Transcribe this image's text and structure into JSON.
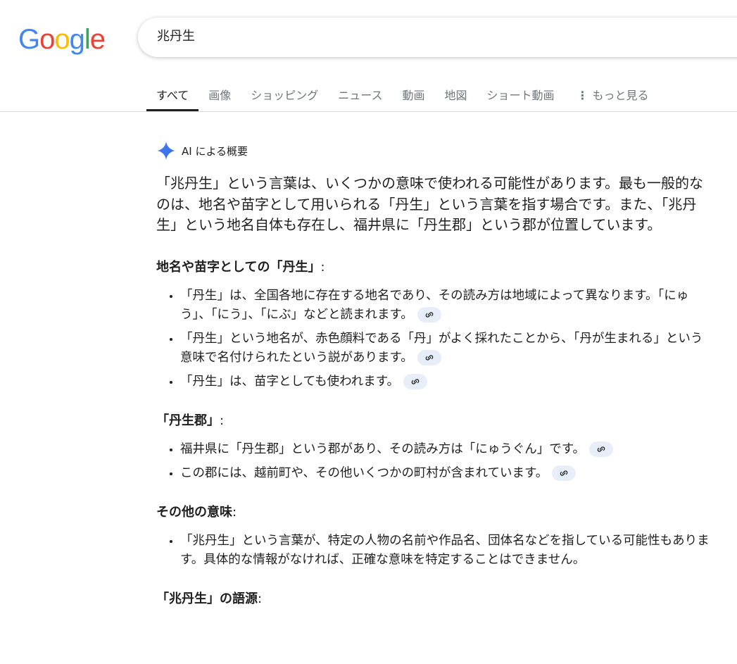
{
  "logo": {
    "letters": [
      "G",
      "o",
      "o",
      "g",
      "l",
      "e"
    ],
    "colors": [
      "#4285F4",
      "#EA4335",
      "#FBBC05",
      "#4285F4",
      "#34A853",
      "#EA4335"
    ]
  },
  "search": {
    "query": "兆丹生"
  },
  "tabs": [
    {
      "label": "すべて",
      "active": true
    },
    {
      "label": "画像"
    },
    {
      "label": "ショッピング"
    },
    {
      "label": "ニュース"
    },
    {
      "label": "動画"
    },
    {
      "label": "地図"
    },
    {
      "label": "ショート動画"
    },
    {
      "label": "もっと見る",
      "icon": "more-vert-icon"
    }
  ],
  "ai": {
    "label": "AI による概要",
    "intro": "「兆丹生」という言葉は、いくつかの意味で使われる可能性があります。最も一般的なのは、地名や苗字として用いられる「丹生」という言葉を指す場合です。また、「兆丹生」という地名自体も存在し、福井県に「丹生郡」という郡が位置しています。",
    "sections": [
      {
        "heading": "地名や苗字としての「丹生」",
        "colon": ":",
        "items": [
          "「丹生」は、全国各地に存在する地名であり、その読み方は地域によって異なります。「にゅう」、「にう」、「にぶ」などと読まれます。",
          "「丹生」という地名が、赤色顔料である「丹」がよく採れたことから、「丹が生まれる」という意味で名付けられたという説があります。",
          "「丹生」は、苗字としても使われます。"
        ]
      },
      {
        "heading": "「丹生郡」",
        "colon": ":",
        "items": [
          "福井県に「丹生郡」という郡があり、その読み方は「にゅうぐん」です。",
          "この郡には、越前町や、その他いくつかの町村が含まれています。"
        ]
      },
      {
        "heading": "その他の意味",
        "colon": ":",
        "items": [
          "「兆丹生」という言葉が、特定の人物の名前や作品名、団体名などを指している可能性もあります。具体的な情報がなければ、正確な意味を特定することはできません。"
        ]
      },
      {
        "heading": "「兆丹生」の語源",
        "colon": ":",
        "items": []
      }
    ]
  }
}
